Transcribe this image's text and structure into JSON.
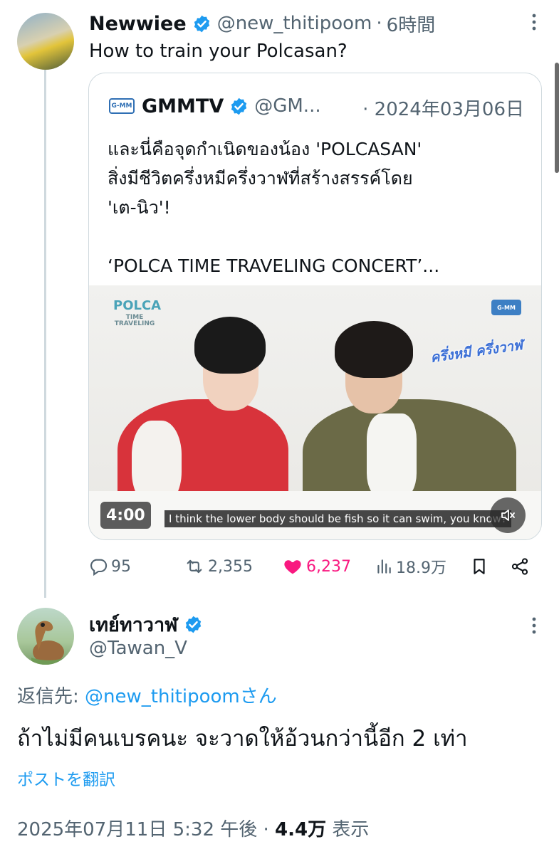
{
  "colors": {
    "verified": "#1d9bf0",
    "like": "#f91880",
    "link": "#1d9bf0",
    "secondary_text": "#536471",
    "primary_text": "#0f1419"
  },
  "post1": {
    "name": "Newwiee",
    "handle": "@new_thitipoom",
    "separator": "·",
    "time": "6時間",
    "text": "How to train your Polcasan?",
    "more_icon": "more-vertical-icon"
  },
  "quoted": {
    "logo_text": "G-MM",
    "name": "GMMTV",
    "handle": "@GM...",
    "date": "· 2024年03月06日",
    "lines": [
      "และนี่คือจุดกำเนิดของน้อง 'POLCASAN'",
      "สิ่งมีชีวิตครึ่งหมีครึ่งวาฬที่สร้างสรรค์โดย",
      "'เต-นิว'!",
      "",
      "‘POLCA TIME TRAVELING CONCERT’..."
    ],
    "video": {
      "logo_left": "POLCA",
      "logo_left_sub": "TIME TRAVELING",
      "logo_right": "G-MM",
      "caption_thai": "ครึ่งหมี ครึ่งวาฬ",
      "subtitle": "I think the lower body should be fish so it can swim, you know?",
      "duration": "4:00"
    }
  },
  "actions": {
    "replies": "95",
    "reposts": "2,355",
    "likes": "6,237",
    "views": "18.9万"
  },
  "post2": {
    "name": "เทย์ทาวาฬ",
    "handle": "@Tawan_V",
    "reply_to_prefix": "返信先: ",
    "reply_to_handle": "@new_thitipoomさん",
    "text": "ถ้าไม่มีคนเบรคนะ จะวาดให้อ้วนกว่านี้อีก 2 เท่า",
    "translate": "ポストを翻訳",
    "timestamp": "2025年07月11日 5:32 午後 · ",
    "views": "4.4万",
    "views_label": " 表示"
  }
}
